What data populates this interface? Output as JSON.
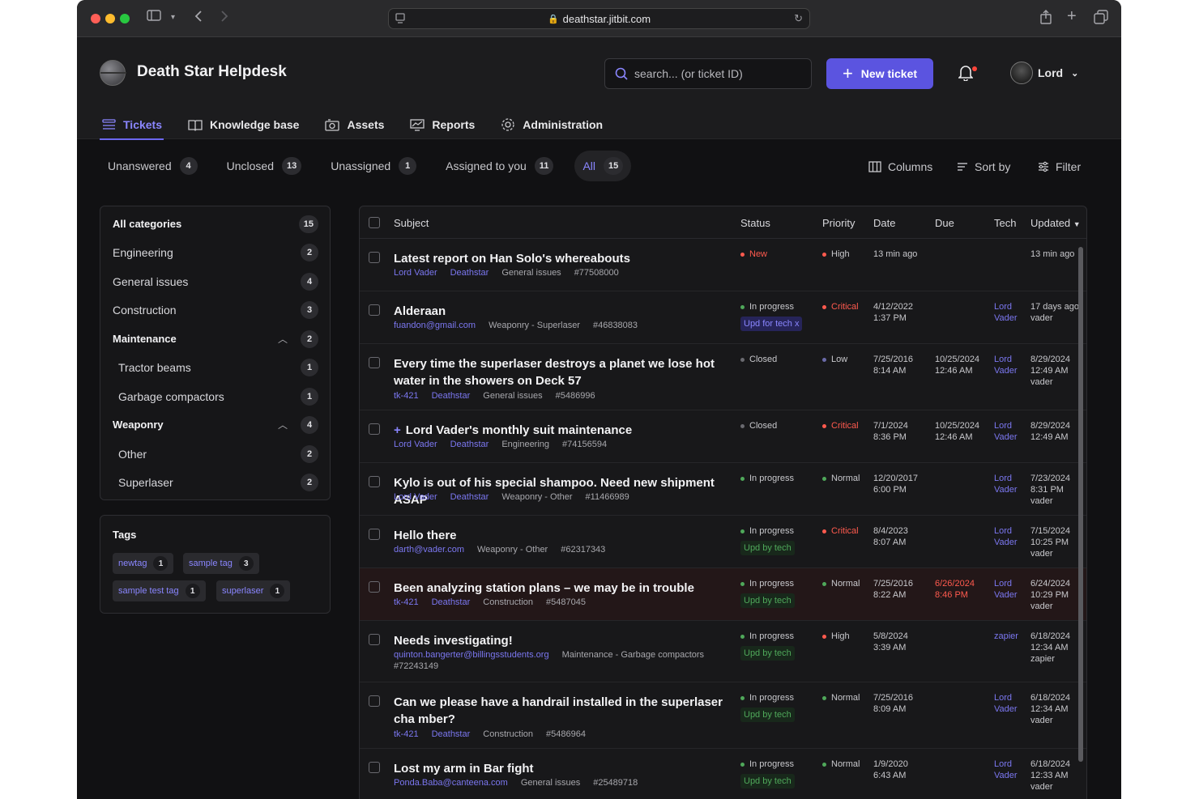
{
  "browser": {
    "url": "deathstar.jitbit.com"
  },
  "header": {
    "app_title": "Death Star Helpdesk",
    "search_placeholder": "search... (or ticket ID)",
    "new_ticket_label": "New ticket",
    "user_name": "Lord"
  },
  "nav": {
    "items": [
      {
        "label": "Tickets",
        "icon": "list-icon",
        "active": true
      },
      {
        "label": "Knowledge base",
        "icon": "book-icon"
      },
      {
        "label": "Assets",
        "icon": "assets-icon"
      },
      {
        "label": "Reports",
        "icon": "chart-icon"
      },
      {
        "label": "Administration",
        "icon": "gear-icon"
      }
    ]
  },
  "filters": {
    "tabs": [
      {
        "label": "Unanswered",
        "count": "4"
      },
      {
        "label": "Unclosed",
        "count": "13"
      },
      {
        "label": "Unassigned",
        "count": "1"
      },
      {
        "label": "Assigned to you",
        "count": "11"
      },
      {
        "label": "All",
        "count": "15",
        "active": true
      }
    ],
    "tools": {
      "columns": "Columns",
      "sort_by": "Sort by",
      "filter": "Filter"
    }
  },
  "categories": [
    {
      "label": "All categories",
      "count": "15",
      "bold": true
    },
    {
      "label": "Engineering",
      "count": "2"
    },
    {
      "label": "General issues",
      "count": "4"
    },
    {
      "label": "Construction",
      "count": "3"
    },
    {
      "label": "Maintenance",
      "count": "2",
      "bold": true,
      "expanded": true
    },
    {
      "label": "Tractor beams",
      "count": "1",
      "sub": true
    },
    {
      "label": "Garbage compactors",
      "count": "1",
      "sub": true
    },
    {
      "label": "Weaponry",
      "count": "4",
      "bold": true,
      "expanded": true
    },
    {
      "label": "Other",
      "count": "2",
      "sub": true
    },
    {
      "label": "Superlaser",
      "count": "2",
      "sub": true
    }
  ],
  "tags": {
    "title": "Tags",
    "items": [
      {
        "label": "newtag",
        "count": "1"
      },
      {
        "label": "sample tag",
        "count": "3"
      },
      {
        "label": "sample test tag",
        "count": "1"
      },
      {
        "label": "superlaser",
        "count": "1"
      }
    ]
  },
  "table": {
    "headers": {
      "subject": "Subject",
      "status": "Status",
      "priority": "Priority",
      "date": "Date",
      "due": "Due",
      "tech": "Tech",
      "updated": "Updated"
    },
    "rows": [
      {
        "subject": "Latest report on Han Solo's whereabouts",
        "meta": [
          {
            "t": "Lord Vader",
            "link": true
          },
          {
            "t": "Deathstar",
            "link": true
          },
          {
            "t": "General issues"
          },
          {
            "t": "#77508000"
          }
        ],
        "status": "New",
        "status_color": "#ff5a4e",
        "status_text_color": "#ff5a4e",
        "upd": "",
        "priority": "High",
        "priority_color": "#ff5a4e",
        "date": "13 min ago",
        "due": "",
        "tech": "",
        "updated": "13 min ago"
      },
      {
        "subject": "Alderaan",
        "meta": [
          {
            "t": "fuandon@gmail.com",
            "link": true
          },
          {
            "t": "Weaponry - Superlaser"
          },
          {
            "t": "#46838083"
          }
        ],
        "status": "In progress",
        "status_color": "#4fa85a",
        "upd": "Upd for tech x",
        "upd_style": "purple",
        "priority": "Critical",
        "priority_color": "#ff5a4e",
        "priority_red": true,
        "date": "4/12/2022\n1:37 PM",
        "due": "",
        "tech": "Lord\nVader",
        "updated": "17 days ago\nvader"
      },
      {
        "subject": "Every time the superlaser destroys a planet we lose hot water in the showers on Deck 57",
        "meta": [
          {
            "t": "tk-421",
            "link": true
          },
          {
            "t": "Deathstar",
            "link": true
          },
          {
            "t": "General issues"
          },
          {
            "t": "#5486996"
          }
        ],
        "status": "Closed",
        "status_color": "#6a6a70",
        "upd": "",
        "priority": "Low",
        "priority_color": "#6a6aa8",
        "date": "7/25/2016\n8:14 AM",
        "due": "10/25/2024\n12:46 AM",
        "tech": "Lord\nVader",
        "updated": "8/29/2024\n12:49 AM\nvader"
      },
      {
        "subject": "Lord Vader's monthly suit maintenance",
        "plus": "+",
        "meta": [
          {
            "t": "Lord Vader",
            "link": true
          },
          {
            "t": "Deathstar",
            "link": true
          },
          {
            "t": "Engineering"
          },
          {
            "t": "#74156594"
          }
        ],
        "status": "Closed",
        "status_color": "#6a6a70",
        "upd": "",
        "priority": "Critical",
        "priority_color": "#ff5a4e",
        "priority_red": true,
        "date": "7/1/2024\n8:36 PM",
        "due": "10/25/2024\n12:46 AM",
        "tech": "Lord\nVader",
        "updated": "8/29/2024\n12:49 AM"
      },
      {
        "subject": "Kylo is out of his special shampoo. Need new shipment ASAP",
        "meta": [
          {
            "t": "Lord Vader",
            "link": true
          },
          {
            "t": "Deathstar",
            "link": true
          },
          {
            "t": "Weaponry - Other"
          },
          {
            "t": "#11466989"
          }
        ],
        "status": "In progress",
        "status_color": "#4fa85a",
        "upd": "",
        "priority": "Normal",
        "priority_color": "#4fa85a",
        "date": "12/20/2017\n6:00 PM",
        "due": "",
        "tech": "Lord\nVader",
        "updated": "7/23/2024\n8:31 PM\nvader"
      },
      {
        "subject": "Hello there",
        "meta": [
          {
            "t": "darth@vader.com",
            "link": true
          },
          {
            "t": "Weaponry - Other"
          },
          {
            "t": "#62317343"
          }
        ],
        "status": "In progress",
        "status_color": "#4fa85a",
        "upd": "Upd by tech",
        "upd_style": "green",
        "priority": "Critical",
        "priority_color": "#ff5a4e",
        "priority_red": true,
        "date": "8/4/2023\n8:07 AM",
        "due": "",
        "tech": "Lord\nVader",
        "updated": "7/15/2024\n10:25 PM\nvader"
      },
      {
        "subject": "Been analyzing station plans – we may be in trouble",
        "meta": [
          {
            "t": "tk-421",
            "link": true
          },
          {
            "t": "Deathstar",
            "link": true
          },
          {
            "t": "Construction"
          },
          {
            "t": "#5487045"
          }
        ],
        "status": "In progress",
        "status_color": "#4fa85a",
        "upd": "Upd by tech",
        "upd_style": "green",
        "priority": "Normal",
        "priority_color": "#4fa85a",
        "date": "7/25/2016\n8:22 AM",
        "due": "6/26/2024\n8:46 PM",
        "due_red": true,
        "tech": "Lord\nVader",
        "updated": "6/24/2024\n10:29 PM\nvader",
        "warn": true
      },
      {
        "subject": "Needs investigating!",
        "meta": [
          {
            "t": "quinton.bangerter@billingsstudents.org",
            "link": true
          },
          {
            "t": "Maintenance - Garbage compactors"
          },
          {
            "t": "#72243149"
          }
        ],
        "status": "In progress",
        "status_color": "#4fa85a",
        "upd": "Upd by tech",
        "upd_style": "green",
        "priority": "High",
        "priority_color": "#ff5a4e",
        "date": "5/8/2024\n3:39 AM",
        "due": "",
        "tech": "zapier",
        "updated": "6/18/2024\n12:34 AM\nzapier"
      },
      {
        "subject": "Can we please have a handrail installed in the superlaser cha mber?",
        "meta": [
          {
            "t": "tk-421",
            "link": true
          },
          {
            "t": "Deathstar",
            "link": true
          },
          {
            "t": "Construction"
          },
          {
            "t": "#5486964"
          }
        ],
        "status": "In progress",
        "status_color": "#4fa85a",
        "upd": "Upd by tech",
        "upd_style": "green",
        "priority": "Normal",
        "priority_color": "#4fa85a",
        "date": "7/25/2016\n8:09 AM",
        "due": "",
        "tech": "Lord\nVader",
        "updated": "6/18/2024\n12:34 AM\nvader"
      },
      {
        "subject": "Lost my arm in Bar fight",
        "meta": [
          {
            "t": "Ponda.Baba@canteena.com",
            "link": true
          },
          {
            "t": "General issues"
          },
          {
            "t": "#25489718"
          }
        ],
        "status": "In progress",
        "status_color": "#4fa85a",
        "upd": "Upd by tech",
        "upd_style": "green",
        "priority": "Normal",
        "priority_color": "#4fa85a",
        "date": "1/9/2020\n6:43 AM",
        "due": "",
        "tech": "Lord\nVader",
        "updated": "6/18/2024\n12:33 AM\nvader"
      }
    ]
  }
}
